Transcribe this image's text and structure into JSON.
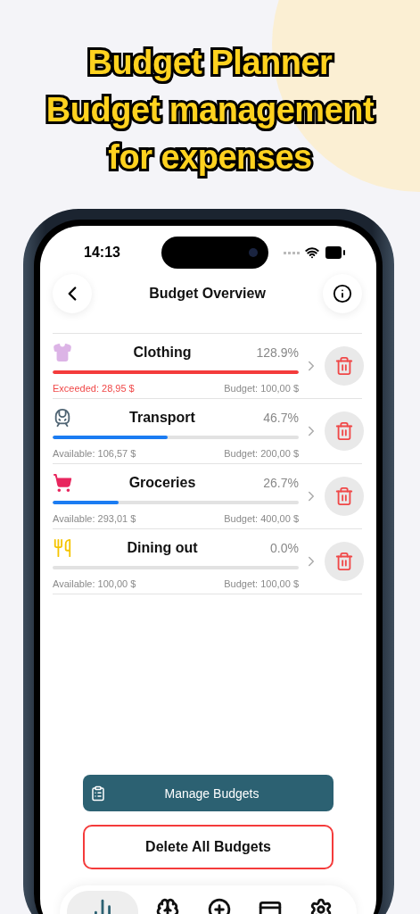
{
  "headline": [
    "Budget Planner",
    "Budget management",
    "for expenses"
  ],
  "status_bar": {
    "time": "14:13"
  },
  "nav": {
    "title": "Budget Overview"
  },
  "budgets": [
    {
      "name": "Clothing",
      "color": "#dcb4e6",
      "percent": "128.9%",
      "level": 1,
      "exceeded": true,
      "left_text": "Exceeded: 28,95 $",
      "budget_text": "Budget: 100,00 $"
    },
    {
      "name": "Transport",
      "color": "#4f6473",
      "percent": "46.7%",
      "level": 0.467,
      "exceeded": false,
      "left_text": "Available: 106,57 $",
      "budget_text": "Budget: 200,00 $"
    },
    {
      "name": "Groceries",
      "color": "#e8265e",
      "percent": "26.7%",
      "level": 0.267,
      "exceeded": false,
      "left_text": "Available: 293,01 $",
      "budget_text": "Budget: 400,00 $"
    },
    {
      "name": "Dining out",
      "color": "#f5c400",
      "percent": "0.0%",
      "level": 0,
      "exceeded": false,
      "left_text": "Available: 100,00 $",
      "budget_text": "Budget: 100,00 $"
    }
  ],
  "buttons": {
    "manage": "Manage Budgets",
    "delete_all": "Delete All Budgets"
  },
  "tab_bar": [
    {
      "selected": true
    },
    {
      "selected": false
    },
    {
      "selected": false
    },
    {
      "selected": false
    },
    {
      "selected": false
    }
  ]
}
